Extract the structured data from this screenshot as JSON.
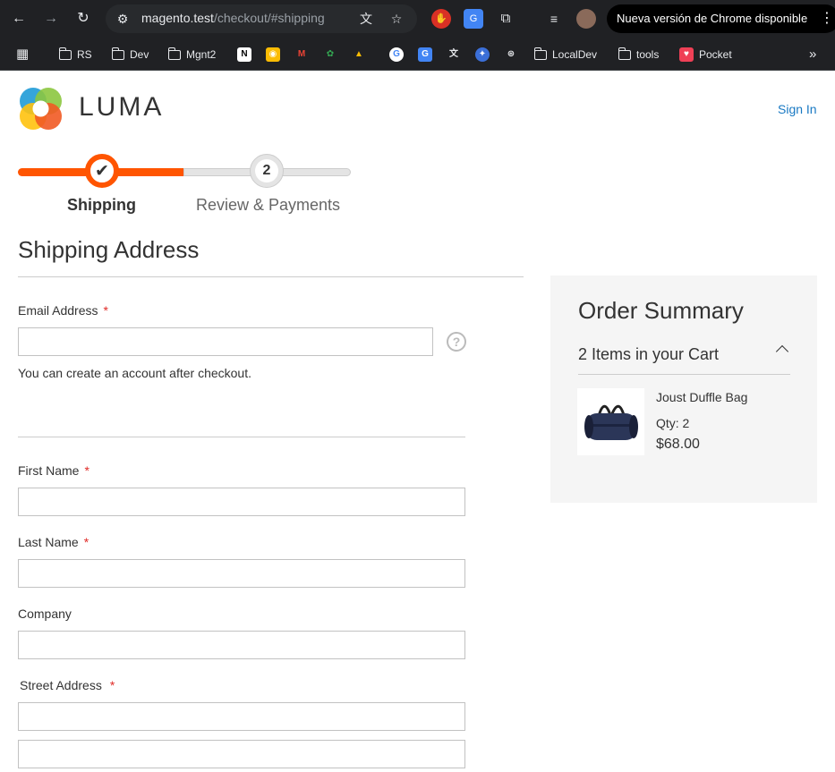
{
  "browser": {
    "url_host": "magento.test",
    "url_path": "/checkout/#shipping",
    "update_notice": "Nueva versión de Chrome disponible"
  },
  "bookmarks": [
    {
      "label": "RS",
      "type": "folder"
    },
    {
      "label": "Dev",
      "type": "folder"
    },
    {
      "label": "Mgnt2",
      "type": "folder"
    },
    {
      "label": "LocalDev",
      "type": "folder"
    },
    {
      "label": "tools",
      "type": "folder"
    },
    {
      "label": "Pocket",
      "type": "link"
    }
  ],
  "header": {
    "logo_text": "LUMA",
    "sign_in": "Sign In"
  },
  "progress": {
    "steps": [
      {
        "label": "Shipping",
        "status": "complete"
      },
      {
        "label": "Review & Payments",
        "number": "2",
        "status": "pending"
      }
    ],
    "accent_color": "#ff5501"
  },
  "shipping": {
    "title": "Shipping Address",
    "required_marker": "*",
    "email_label": "Email Address",
    "email_value": "",
    "email_note": "You can create an account after checkout.",
    "first_name_label": "First Name",
    "last_name_label": "Last Name",
    "company_label": "Company",
    "street_label": "Street Address"
  },
  "summary": {
    "title": "Order Summary",
    "cart_count": "2 Items in your Cart",
    "items": [
      {
        "name": "Joust Duffle Bag",
        "qty": "Qty: 2",
        "price": "$68.00"
      }
    ]
  }
}
